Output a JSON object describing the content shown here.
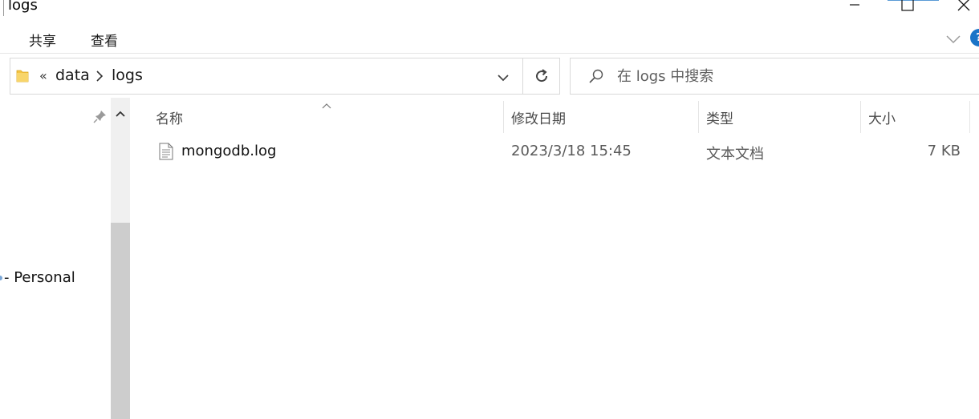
{
  "window": {
    "title": "logs",
    "controls": {
      "minimize": "minimize",
      "maximize": "maximize",
      "close": "close"
    }
  },
  "ribbon": {
    "tabs": [
      {
        "label": "共享"
      },
      {
        "label": "查看"
      }
    ],
    "help_label": "?"
  },
  "address_bar": {
    "overflow": "«",
    "breadcrumbs": [
      {
        "label": "data"
      },
      {
        "label": "logs"
      }
    ]
  },
  "search": {
    "placeholder": "在 logs 中搜索"
  },
  "nav_pane": {
    "items": [
      {
        "label": "- Personal"
      }
    ]
  },
  "file_list": {
    "columns": [
      {
        "label": "名称"
      },
      {
        "label": "修改日期"
      },
      {
        "label": "类型"
      },
      {
        "label": "大小"
      }
    ],
    "rows": [
      {
        "name": "mongodb.log",
        "modified": "2023/3/18 15:45",
        "type": "文本文档",
        "size": "7 KB"
      }
    ]
  },
  "colors": {
    "accent": "#1a73c7",
    "folder_yellow": "#f4c443",
    "scroll_thumb": "#cdcdcd"
  },
  "icons": {
    "folder": "folder-icon",
    "chevron_right": "chevron-right-icon",
    "chevron_down": "chevron-down-icon",
    "refresh": "refresh-icon",
    "search": "search-icon",
    "pin": "pin-icon",
    "file": "text-file-icon"
  }
}
